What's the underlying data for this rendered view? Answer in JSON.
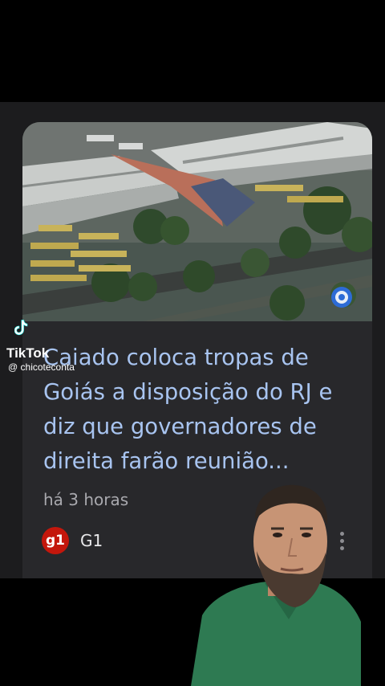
{
  "article": {
    "headline": "Caiado coloca tropas de Goiás a disposição do RJ e diz que governadores de direita farão reunião...",
    "time": "há 3 horas",
    "source": "G1",
    "source_logo_text": "g1"
  },
  "overlay": {
    "app": "TikTok",
    "handle": "@ chicoteconta"
  },
  "icons": {
    "thumbnail": "aerial-bus-terminal-photo",
    "broadcaster": "globo-logo-icon",
    "menu": "more-vert-icon",
    "tiktok": "tiktok-note-icon"
  },
  "colors": {
    "headline": "#a8c4f0",
    "card": "#28282b",
    "panel": "#1c1c1e",
    "g1_red": "#c4170c",
    "shirt": "#2e7a52"
  }
}
